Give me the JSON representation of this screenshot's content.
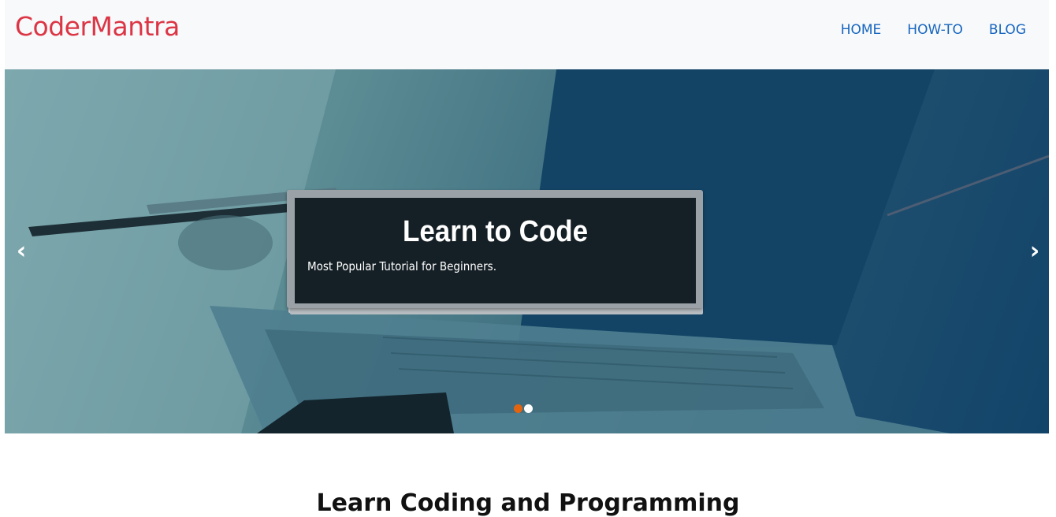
{
  "brand": {
    "name": "CoderMantra",
    "color": "#dc3545"
  },
  "nav": {
    "items": [
      {
        "label": "HOME"
      },
      {
        "label": "HOW-TO"
      },
      {
        "label": "BLOG"
      }
    ],
    "link_color": "#1565c0"
  },
  "carousel": {
    "caption": {
      "title": "Learn to Code",
      "text": "Most Popular Tutorial for Beginners."
    },
    "controls": {
      "prev_icon": "chevron-left-icon",
      "next_icon": "chevron-right-icon"
    },
    "indicators": [
      {
        "active": true,
        "color": "#e3640f"
      },
      {
        "active": false,
        "color": "#ffffff"
      }
    ]
  },
  "section": {
    "heading": "Learn Coding and Programming"
  }
}
